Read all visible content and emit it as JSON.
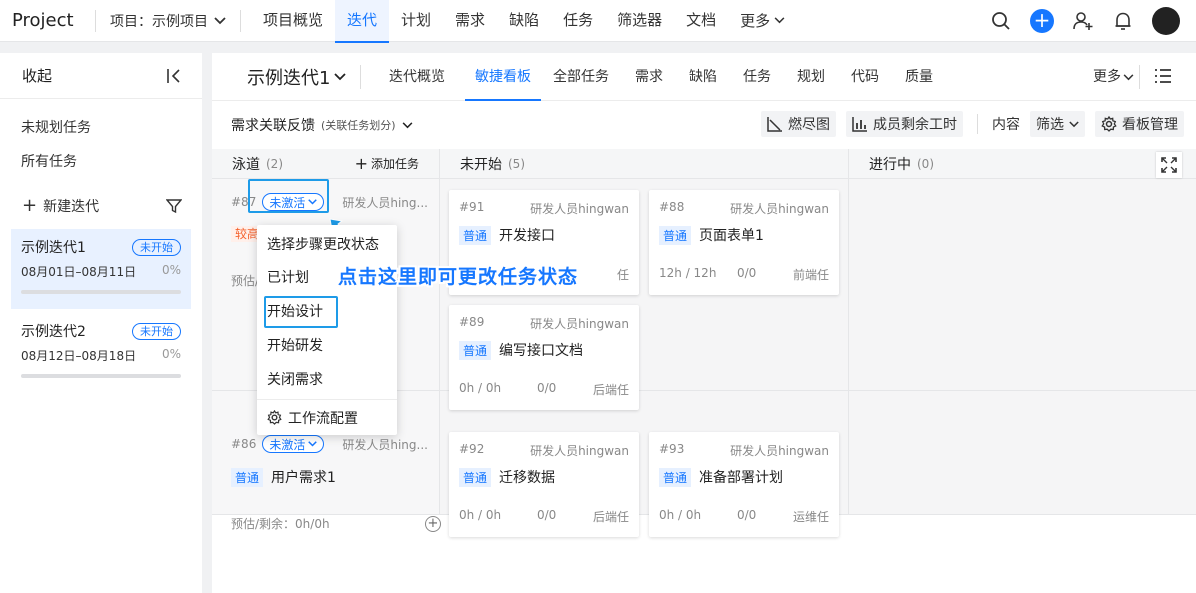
{
  "topnav": {
    "brand": "Project",
    "project_selector": "项目：示例项目",
    "items": [
      {
        "label": "项目概览",
        "active": false
      },
      {
        "label": "迭代",
        "active": true
      },
      {
        "label": "计划",
        "active": false
      },
      {
        "label": "需求",
        "active": false
      },
      {
        "label": "缺陷",
        "active": false
      },
      {
        "label": "任务",
        "active": false
      },
      {
        "label": "筛选器",
        "active": false
      },
      {
        "label": "文档",
        "active": false
      },
      {
        "label": "更多",
        "active": false
      }
    ],
    "icons": [
      "search-icon",
      "add-icon",
      "add-member-icon",
      "bell-icon",
      "avatar"
    ]
  },
  "sidebar": {
    "collapse_label": "收起",
    "links": [
      "未规划任务",
      "所有任务"
    ],
    "new_iteration": "新建迭代",
    "iterations": [
      {
        "name": "示例迭代1",
        "status": "未开始",
        "dates": "08月01日–08月11日",
        "progress": "0%",
        "active": true
      },
      {
        "name": "示例迭代2",
        "status": "未开始",
        "dates": "08月12日–08月18日",
        "progress": "0%",
        "active": false
      }
    ]
  },
  "iteration_header": {
    "title": "示例迭代1",
    "tabs": [
      {
        "label": "迭代概览",
        "active": false
      },
      {
        "label": "敏捷看板",
        "active": true
      },
      {
        "label": "全部任务",
        "active": false
      },
      {
        "label": "需求",
        "active": false
      },
      {
        "label": "缺陷",
        "active": false
      },
      {
        "label": "任务",
        "active": false
      },
      {
        "label": "规划",
        "active": false
      },
      {
        "label": "代码",
        "active": false
      },
      {
        "label": "质量",
        "active": false
      }
    ],
    "more": "更多"
  },
  "toolbar": {
    "title": "需求关联反馈",
    "subtitle": "(关联任务划分)",
    "burndown": "燃尽图",
    "member_hours": "成员剩余工时",
    "content_label": "内容",
    "filter": "筛选",
    "board_manage": "看板管理"
  },
  "board": {
    "lane_header": {
      "label": "泳道",
      "count": "(2)",
      "add_task": "添加任务"
    },
    "columns": [
      {
        "label": "未开始",
        "count": "(5)"
      },
      {
        "label": "进行中",
        "count": "(0)"
      }
    ],
    "lanes": [
      {
        "id": "#87",
        "status": "未激活",
        "assignee": "研发人员hing...",
        "priority": "较高",
        "estimate": "预估/"
      },
      {
        "id": "#86",
        "status": "未激活",
        "assignee": "研发人员hing...",
        "priority": "普通",
        "title": "用户需求1",
        "estimate": "预估/剩余：0h/0h"
      }
    ],
    "cards": [
      {
        "id": "#91",
        "assignee": "研发人员hingwan",
        "tag": "普通",
        "title": "开发接口",
        "hours": "",
        "progress": "",
        "role": "任"
      },
      {
        "id": "#88",
        "assignee": "研发人员hingwan",
        "tag": "普通",
        "title": "页面表单1",
        "hours": "12h / 12h",
        "progress": "0/0",
        "role": "前端任"
      },
      {
        "id": "#89",
        "assignee": "研发人员hingwan",
        "tag": "普通",
        "title": "编写接口文档",
        "hours": "0h / 0h",
        "progress": "0/0",
        "role": "后端任"
      },
      {
        "id": "#92",
        "assignee": "研发人员hingwan",
        "tag": "普通",
        "title": "迁移数据",
        "hours": "0h / 0h",
        "progress": "0/0",
        "role": "后端任"
      },
      {
        "id": "#93",
        "assignee": "研发人员hingwan",
        "tag": "普通",
        "title": "准备部署计划",
        "hours": "0h / 0h",
        "progress": "0/0",
        "role": "运维任"
      }
    ]
  },
  "dropdown": {
    "header": "选择步骤更改状态",
    "items": [
      "已计划",
      "开始设计",
      "开始研发",
      "关闭需求"
    ],
    "footer": "工作流配置"
  },
  "callout": "点击这里即可更改任务状态"
}
